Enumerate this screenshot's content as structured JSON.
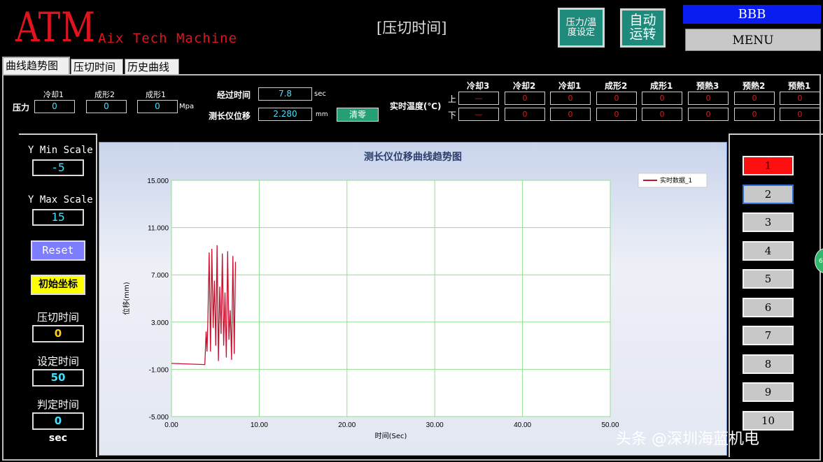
{
  "header": {
    "logo": "ATM",
    "logo_subtitle": "Aix Tech Machine",
    "screen_title": "[压切时间]",
    "pressure_temp_button": "压力/温\n度设定",
    "auto_run_button": "自动\n运转",
    "user": "BBB",
    "menu_button": "MENU"
  },
  "tabs": [
    "曲线趋势图",
    "压切时间",
    "历史曲线"
  ],
  "info": {
    "pressure_label": "压力",
    "pressure_fields": [
      {
        "label": "冷却1",
        "value": "0"
      },
      {
        "label": "成形2",
        "value": "0"
      },
      {
        "label": "成形1",
        "value": "0"
      }
    ],
    "pressure_unit": "Mpa",
    "elapsed_label": "经过时间",
    "elapsed_value": "7.8",
    "elapsed_unit": "sec",
    "displacement_label": "测长仪位移",
    "displacement_value": "2.280",
    "displacement_unit": "mm",
    "clear_button": "清零",
    "temp_label": "实时温度(℃)",
    "upper_label": "上",
    "lower_label": "下",
    "temp_columns": [
      {
        "label": "冷却3",
        "upper": "—",
        "lower": "—"
      },
      {
        "label": "冷却2",
        "upper": "0",
        "lower": "0"
      },
      {
        "label": "冷却1",
        "upper": "0",
        "lower": "0"
      },
      {
        "label": "成形2",
        "upper": "0",
        "lower": "0"
      },
      {
        "label": "成形1",
        "upper": "0",
        "lower": "0"
      },
      {
        "label": "预熱3",
        "upper": "0",
        "lower": "0"
      },
      {
        "label": "预熱2",
        "upper": "0",
        "lower": "0"
      },
      {
        "label": "预熱1",
        "upper": "0",
        "lower": "0"
      }
    ]
  },
  "left_panel": {
    "y_min_label": "Y Min Scale",
    "y_min_value": "-5",
    "y_max_label": "Y Max Scale",
    "y_max_value": "15",
    "reset_button": "Reset",
    "init_button": "初始坐标",
    "press_time_label": "压切时间",
    "press_time_value": "0",
    "set_time_label": "设定时间",
    "set_time_value": "50",
    "judge_time_label": "判定时间",
    "judge_time_value": "0",
    "unit": "sec"
  },
  "right_panel": {
    "buttons": [
      "1",
      "2",
      "3",
      "4",
      "5",
      "6",
      "7",
      "8",
      "9",
      "10"
    ],
    "colors": {
      "active": "#ff1010",
      "normal": "#c8c8c8",
      "focus_border": "#2e6dd8"
    }
  },
  "side_badge": "6",
  "watermark": "头条 @深圳海蓝机电",
  "chart_data": {
    "type": "line",
    "title": "测长仪位移曲线趋势图",
    "xlabel": "时间(Sec)",
    "ylabel": "位移(mm)",
    "xlim": [
      0,
      50
    ],
    "ylim": [
      -5,
      15
    ],
    "x_ticks": [
      "0.00",
      "10.00",
      "20.00",
      "30.00",
      "40.00",
      "50.00"
    ],
    "y_ticks": [
      "15.000",
      "11.000",
      "7.000",
      "3.000",
      "-1.000",
      "-5.000"
    ],
    "grid": true,
    "grid_color": "#8fe08f",
    "legend_position": "top-right",
    "series": [
      {
        "name": "实时数据_1",
        "color": "#c8102e",
        "x": [
          0,
          3.8,
          3.95,
          4.05,
          4.15,
          4.3,
          4.45,
          4.6,
          4.75,
          4.9,
          5.05,
          5.2,
          5.35,
          5.5,
          5.65,
          5.8,
          5.95,
          6.1,
          6.25,
          6.4,
          6.55,
          6.7,
          6.85,
          7.0,
          7.15,
          7.3
        ],
        "y": [
          -0.5,
          -0.6,
          2.2,
          0.5,
          3.0,
          8.9,
          0.5,
          9.2,
          2.5,
          6.5,
          1.0,
          9.5,
          -0.3,
          6.0,
          2.0,
          8.8,
          1.0,
          5.5,
          0.0,
          9.0,
          1.5,
          4.0,
          -0.2,
          8.6,
          0.3,
          8.1
        ]
      }
    ]
  }
}
